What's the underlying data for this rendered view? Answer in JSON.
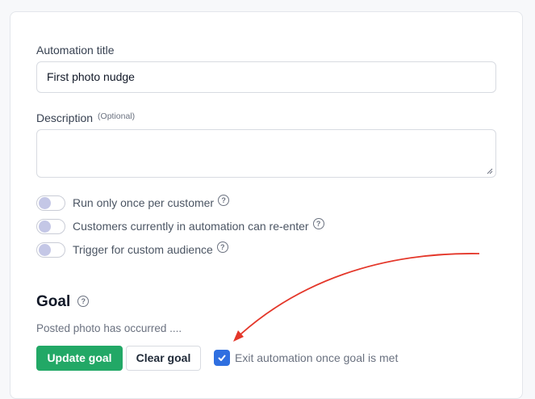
{
  "form": {
    "title_label": "Automation title",
    "title_value": "First photo nudge",
    "description_label": "Description",
    "description_optional": "(Optional)",
    "description_value": ""
  },
  "toggles": [
    {
      "label": "Run only once per customer",
      "on": false
    },
    {
      "label": "Customers currently in automation can re-enter",
      "on": false
    },
    {
      "label": "Trigger for custom audience",
      "on": false
    }
  ],
  "goal": {
    "title": "Goal",
    "description": "Posted photo has occurred ....",
    "update_button": "Update goal",
    "clear_button": "Clear goal",
    "exit_checkbox_label": "Exit automation once goal is met",
    "exit_checked": true
  },
  "icons": {
    "help": "question-circle-icon",
    "check": "check-icon"
  },
  "colors": {
    "primary_button": "#22a866",
    "checkbox": "#2f6fe0",
    "annotation_arrow": "#e4372a"
  }
}
